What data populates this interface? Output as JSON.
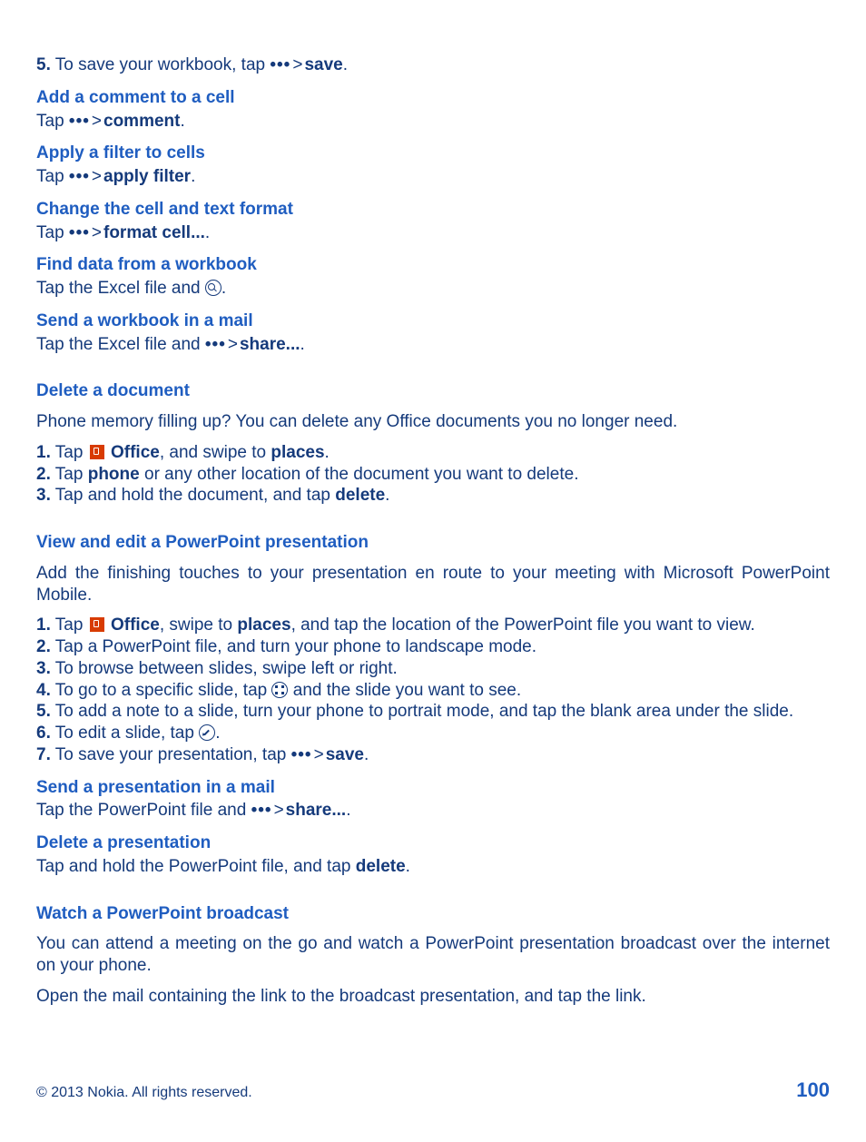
{
  "step5": {
    "num": "5.",
    "pre": " To save your workbook, tap ",
    "gt": " > ",
    "save": "save",
    "dot": "."
  },
  "addComment": {
    "heading": "Add a comment to a cell",
    "tap": "Tap ",
    "gt": " > ",
    "target": "comment",
    "dot": "."
  },
  "applyFilter": {
    "heading": "Apply a filter to cells",
    "tap": "Tap ",
    "gt": " > ",
    "target": "apply filter",
    "dot": "."
  },
  "formatCell": {
    "heading": "Change the cell and text format",
    "tap": "Tap ",
    "gt": " > ",
    "target": "format cell...",
    "dot": "."
  },
  "findData": {
    "heading": "Find data from a workbook",
    "pre": "Tap the Excel file and ",
    "dot": "."
  },
  "sendWorkbook": {
    "heading": "Send a workbook in a mail",
    "pre": "Tap the Excel file and ",
    "gt": " > ",
    "target": "share...",
    "dot": "."
  },
  "deleteDoc": {
    "heading": "Delete a document",
    "intro": "Phone memory filling up? You can delete any Office documents you no longer need.",
    "s1": {
      "num": "1.",
      "pre": " Tap ",
      "office": "Office",
      "mid": ", and swipe to ",
      "places": "places",
      "dot": "."
    },
    "s2": {
      "num": "2.",
      "pre": " Tap ",
      "phone": "phone",
      "post": " or any other location of the document you want to delete."
    },
    "s3": {
      "num": "3.",
      "pre": " Tap and hold the document, and tap ",
      "del": "delete",
      "dot": "."
    }
  },
  "viewPpt": {
    "heading": "View and edit a PowerPoint presentation",
    "intro": "Add the finishing touches to your presentation en route to your meeting with Microsoft PowerPoint Mobile.",
    "s1": {
      "num": "1.",
      "pre": " Tap ",
      "office": "Office",
      "mid1": ", swipe to ",
      "places": "places",
      "post": ", and tap the location of the PowerPoint file you want to view."
    },
    "s2": {
      "num": "2.",
      "text": " Tap a PowerPoint file, and turn your phone to landscape mode."
    },
    "s3": {
      "num": "3.",
      "text": " To browse between slides, swipe left or right."
    },
    "s4": {
      "num": "4.",
      "pre": " To go to a specific slide, tap ",
      "post": " and the slide you want to see."
    },
    "s5": {
      "num": "5.",
      "text": " To add a note to a slide, turn your phone to portrait mode, and tap the blank area under the slide."
    },
    "s6": {
      "num": "6.",
      "pre": " To edit a slide, tap ",
      "dot": "."
    },
    "s7": {
      "num": "7.",
      "pre": " To save your presentation, tap ",
      "gt": " > ",
      "save": "save",
      "dot": "."
    }
  },
  "sendPpt": {
    "heading": "Send a presentation in a mail",
    "pre": "Tap the PowerPoint file and ",
    "gt": " > ",
    "target": "share...",
    "dot": "."
  },
  "deletePpt": {
    "heading": "Delete a presentation",
    "pre": "Tap and hold the PowerPoint file, and tap ",
    "del": "delete",
    "dot": "."
  },
  "broadcast": {
    "heading": "Watch a PowerPoint broadcast",
    "p1": "You can attend a meeting on the go and watch a PowerPoint presentation broadcast over the internet on your phone.",
    "p2": "Open the mail containing the link to the broadcast presentation, and tap the link."
  },
  "footer": {
    "copyright": "© 2013 Nokia. All rights reserved.",
    "page": "100"
  }
}
